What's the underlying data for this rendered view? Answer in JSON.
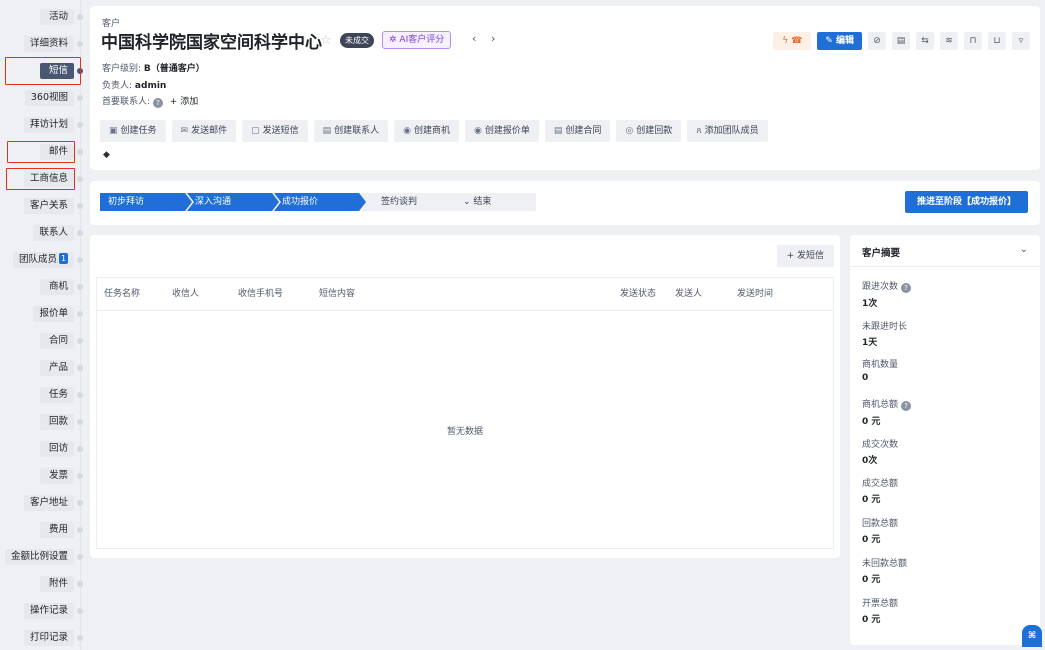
{
  "nav": {
    "items": [
      {
        "label": "活动",
        "active": false
      },
      {
        "label": "详细资料",
        "active": false
      },
      {
        "label": "短信",
        "active": true
      },
      {
        "label": "360视图",
        "active": false
      },
      {
        "label": "拜访计划",
        "active": false
      },
      {
        "label": "邮件",
        "active": false
      },
      {
        "label": "工商信息",
        "active": false
      },
      {
        "label": "客户关系",
        "active": false
      },
      {
        "label": "联系人",
        "active": false
      },
      {
        "label": "团队成员",
        "active": false,
        "badge": "1"
      },
      {
        "label": "商机",
        "active": false
      },
      {
        "label": "报价单",
        "active": false
      },
      {
        "label": "合同",
        "active": false
      },
      {
        "label": "产品",
        "active": false
      },
      {
        "label": "任务",
        "active": false
      },
      {
        "label": "回款",
        "active": false
      },
      {
        "label": "回访",
        "active": false
      },
      {
        "label": "发票",
        "active": false
      },
      {
        "label": "客户地址",
        "active": false
      },
      {
        "label": "费用",
        "active": false
      },
      {
        "label": "金额比例设置",
        "active": false
      },
      {
        "label": "附件",
        "active": false
      },
      {
        "label": "操作记录",
        "active": false
      },
      {
        "label": "打印记录",
        "active": false
      }
    ]
  },
  "header": {
    "crumb": "客户",
    "title": "中国科学院国家空间科学中心",
    "status": "未成交",
    "ai_label": "AI客户评分",
    "prev": "‹",
    "next": "›",
    "level_label": "客户级别:",
    "level_value": "B（普通客户）",
    "owner_label": "负责人:",
    "owner_value": "admin",
    "contact_label": "首要联系人:",
    "contact_add": "+ 添加",
    "edit_label": "编辑",
    "actions": [
      {
        "icon": "▣",
        "label": "创建任务"
      },
      {
        "icon": "✉",
        "label": "发送邮件"
      },
      {
        "icon": "▢",
        "label": "发送短信"
      },
      {
        "icon": "▤",
        "label": "创建联系人"
      },
      {
        "icon": "◉",
        "label": "创建商机"
      },
      {
        "icon": "◉",
        "label": "创建报价单"
      },
      {
        "icon": "▤",
        "label": "创建合同"
      },
      {
        "icon": "◎",
        "label": "创建回款"
      },
      {
        "icon": "ጸ",
        "label": "添加团队成员"
      }
    ]
  },
  "stages": {
    "items": [
      {
        "label": "初步拜访",
        "done": true
      },
      {
        "label": "深入沟通",
        "done": true
      },
      {
        "label": "成功报价",
        "done": true
      },
      {
        "label": "签约谈判",
        "done": false
      },
      {
        "label": "结束",
        "done": false,
        "dropdown": true
      }
    ],
    "advance_label": "推进至阶段【成功报价】"
  },
  "sms": {
    "send_button": "+ 发短信",
    "columns": [
      "任务名称",
      "收信人",
      "收信手机号",
      "短信内容",
      "发送状态",
      "发送人",
      "发送时间"
    ],
    "empty_text": "暂无数据"
  },
  "summary": {
    "title": "客户摘要",
    "items": [
      {
        "label": "跟进次数",
        "value": "1次",
        "help": true
      },
      {
        "label": "未跟进时长",
        "value": "1天",
        "help": false
      },
      {
        "label": "商机数量",
        "value": "0",
        "help": false
      },
      {
        "label": "商机总额",
        "value": "0 元",
        "help": true
      },
      {
        "label": "成交次数",
        "value": "0次",
        "help": false
      },
      {
        "label": "成交总额",
        "value": "0 元",
        "help": false
      },
      {
        "label": "回款总额",
        "value": "0 元",
        "help": false
      },
      {
        "label": "未回款总额",
        "value": "0 元",
        "help": false
      },
      {
        "label": "开票总额",
        "value": "0 元",
        "help": false
      }
    ]
  },
  "colors": {
    "accent": "#1f6fd6",
    "active_nav": "#4a5773",
    "highlight": "#e0301e"
  }
}
